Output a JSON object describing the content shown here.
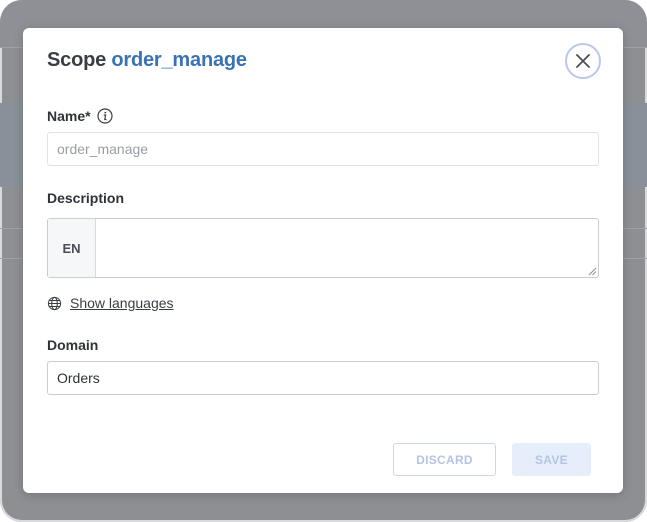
{
  "modal": {
    "title_prefix": "Scope",
    "title_name": "order_manage"
  },
  "form": {
    "name_label": "Name*",
    "name_value": "order_manage",
    "description_label": "Description",
    "description_lang": "EN",
    "description_value": "",
    "show_languages": "Show languages",
    "domain_label": "Domain",
    "domain_value": "Orders"
  },
  "actions": {
    "discard_label": "DISCARD",
    "save_label": "SAVE"
  },
  "colors": {
    "accent": "#3b72b4",
    "overlay": "#8d8f93",
    "disabled_button_text": "#b5c4e3"
  },
  "icons": {
    "close": "close-icon",
    "info": "info-icon",
    "globe": "globe-icon"
  }
}
